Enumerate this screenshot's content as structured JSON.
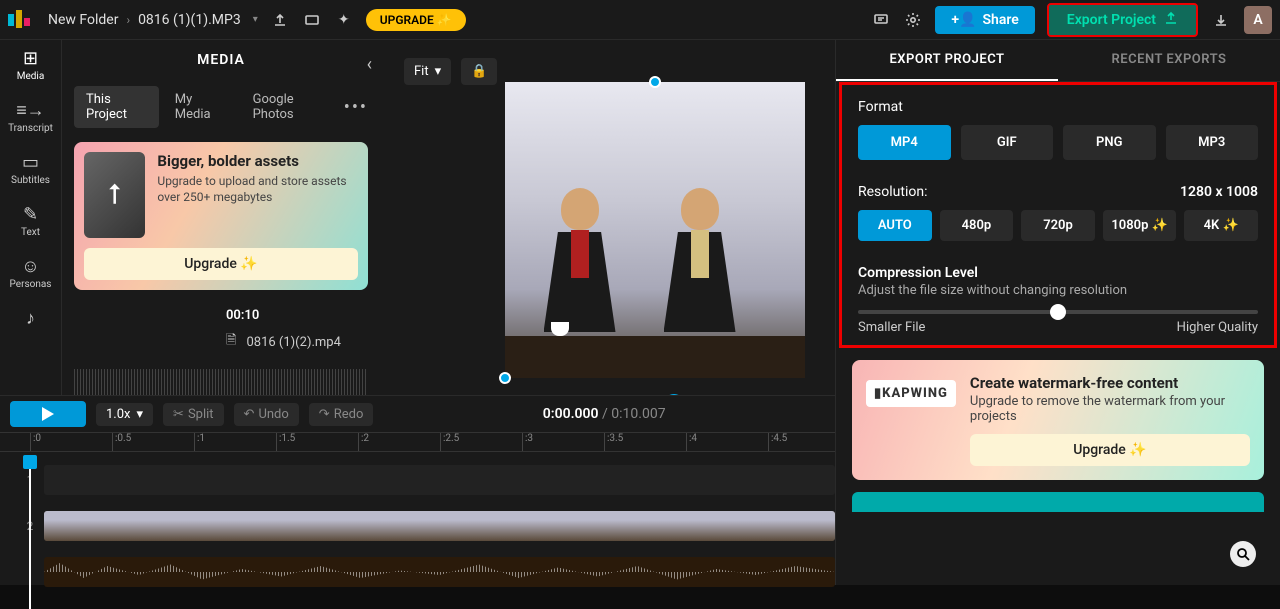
{
  "header": {
    "breadcrumb_folder": "New Folder",
    "breadcrumb_file": "0816 (1)(1).MP3",
    "upgrade": "UPGRADE ✨",
    "share": "Share",
    "export": "Export Project",
    "avatar_letter": "A"
  },
  "rail": {
    "media": "Media",
    "transcript": "Transcript",
    "subtitles": "Subtitles",
    "text": "Text",
    "personas": "Personas"
  },
  "media_panel": {
    "title": "MEDIA",
    "tabs": {
      "this_project": "This Project",
      "my_media": "My Media",
      "google_photos": "Google Photos"
    },
    "upgrade_card": {
      "title": "Bigger, bolder assets",
      "body": "Upgrade to upload and store assets over 250+ megabytes",
      "cta": "Upgrade ✨"
    },
    "file": {
      "duration": "00:10",
      "name": "0816 (1)(2).mp4"
    }
  },
  "canvas": {
    "fit_label": "Fit"
  },
  "export_panel": {
    "tab_export": "EXPORT PROJECT",
    "tab_recent": "RECENT EXPORTS",
    "format_label": "Format",
    "formats": {
      "mp4": "MP4",
      "gif": "GIF",
      "png": "PNG",
      "mp3": "MP3"
    },
    "resolution_label": "Resolution:",
    "resolution_value": "1280 x 1008",
    "resolutions": {
      "auto": "AUTO",
      "r480": "480p",
      "r720": "720p",
      "r1080": "1080p ✨",
      "r4k": "4K ✨"
    },
    "compression": {
      "title": "Compression Level",
      "subtitle": "Adjust the file size without changing resolution",
      "left": "Smaller File",
      "right": "Higher Quality"
    },
    "watermark": {
      "brand": "▮KAPWING",
      "title": "Create watermark-free content",
      "body": "Upgrade to remove the watermark from your projects",
      "cta": "Upgrade ✨"
    }
  },
  "timeline": {
    "zoom": "1.0x",
    "split": "Split",
    "undo": "Undo",
    "redo": "Redo",
    "time_current": "0:00.000",
    "time_total": "0:10.007",
    "ticks": [
      ":0",
      ":0.5",
      ":1",
      ":1.5",
      ":2",
      ":2.5",
      ":3",
      ":3.5",
      ":4",
      ":4.5"
    ],
    "track1": "1",
    "track2": "2"
  }
}
